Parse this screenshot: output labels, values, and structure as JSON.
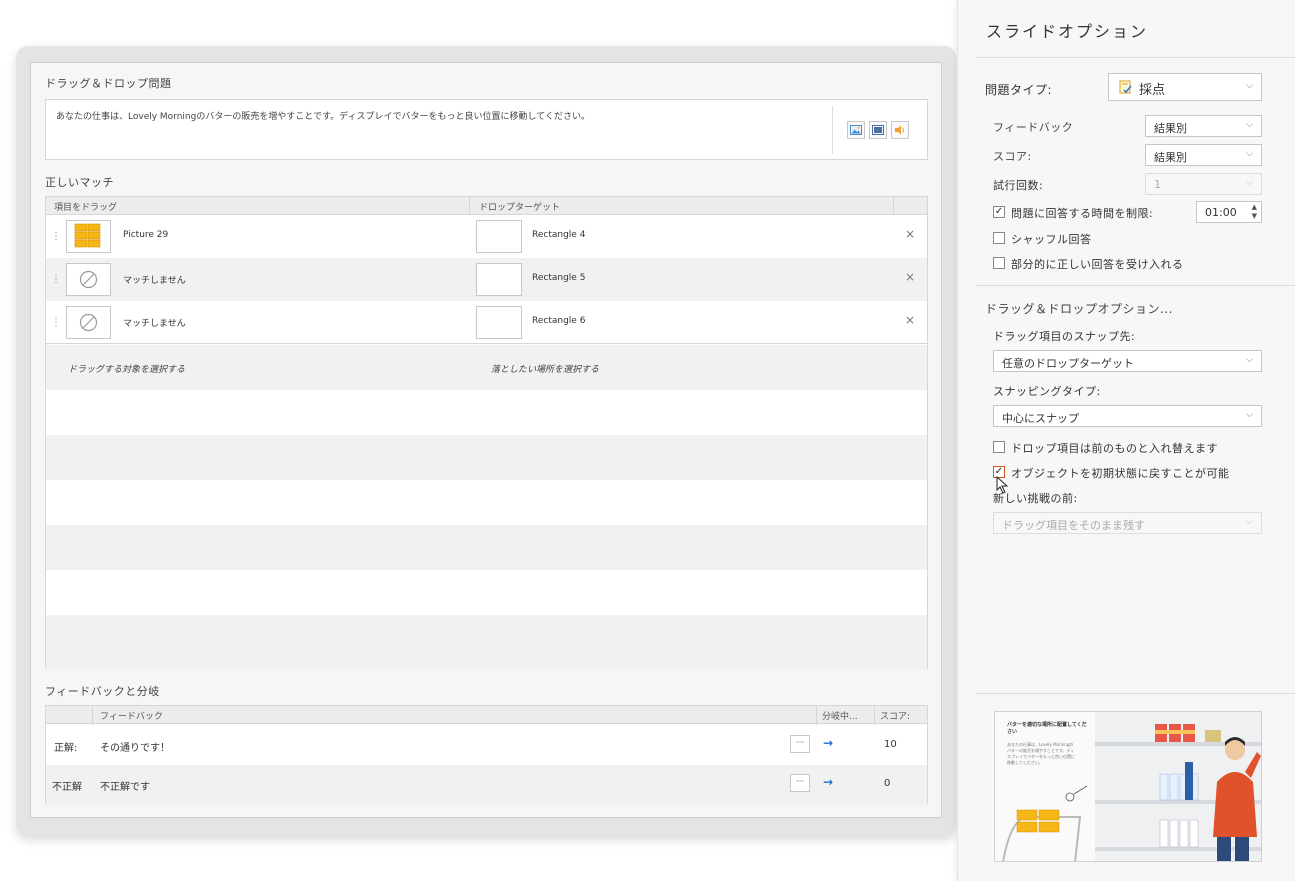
{
  "editor": {
    "question_section_title": "ドラッグ＆ドロップ問題",
    "question_text": "あなたの仕事は、Lovely Morningのバターの販売を増やすことです。ディスプレイでバターをもっと良い位置に移動してください。",
    "match_section_title": "正しいマッチ",
    "col_drag": "項目をドラッグ",
    "col_drop": "ドロップターゲット",
    "rows": [
      {
        "drag": "Picture 29",
        "target": "Rectangle 4"
      },
      {
        "drag": "マッチしません",
        "target": "Rectangle 5"
      },
      {
        "drag": "マッチしません",
        "target": "Rectangle 6"
      }
    ],
    "placeholder_drag": "ドラッグする対象を選択する",
    "placeholder_drop": "落としたい場所を選択する",
    "feedback_section_title": "フィードバックと分岐",
    "fb_col_feedback": "フィードバック",
    "fb_col_branch": "分岐中...",
    "fb_col_score": "スコア:",
    "feedback_rows": [
      {
        "label": "正解:",
        "text": "その通りです！",
        "dots": "···",
        "score": "10"
      },
      {
        "label": "不正解",
        "text": "不正解です",
        "dots": "···",
        "score": "0"
      }
    ]
  },
  "panel": {
    "title": "スライドオプション",
    "question_type_label": "問題タイプ:",
    "question_type_value": "採点",
    "feedback_label": "フィードバック",
    "feedback_value": "結果別",
    "score_label": "スコア:",
    "score_value": "結果別",
    "attempts_label": "試行回数:",
    "attempts_value": "1",
    "time_limit_label": "問題に回答する時間を制限:",
    "time_limit_value": "01:00",
    "shuffle_label": "シャッフル回答",
    "partial_label": "部分的に正しい回答を受け入れる",
    "dd_section_title": "ドラッグ＆ドロップオプション...",
    "snap_label": "ドラッグ項目のスナップ先:",
    "snap_value": "任意のドロップターゲット",
    "snap_type_label": "スナッピングタイプ:",
    "snap_type_value": "中心にスナップ",
    "replace_label": "ドロップ項目は前のものと入れ替えます",
    "reset_label": "オブジェクトを初期状態に戻すことが可能",
    "before_retry_label": "新しい挑戦の前:",
    "before_retry_value": "ドラッグ項目をそのまま残す",
    "checks": {
      "time_limit": true,
      "shuffle": false,
      "partial": false,
      "replace": false,
      "reset": true
    }
  },
  "preview": {
    "heading": "バターを適切な場所に配置してください",
    "body": "あなたの仕事は、Lovely Morningのバターの販売を増やすことです。ディスプレイでバターをもっと良い位置に移動してください。"
  }
}
